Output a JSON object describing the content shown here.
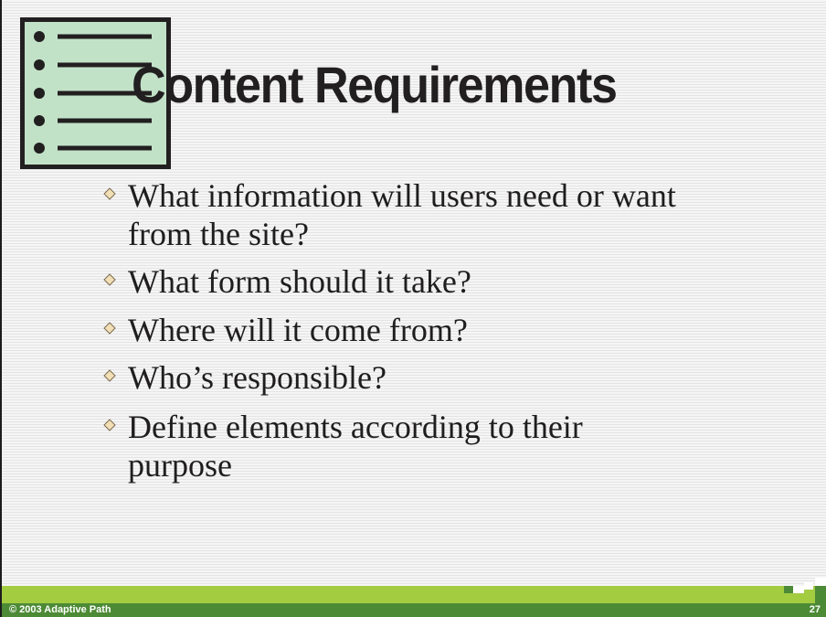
{
  "slide": {
    "title": "Content Requirements",
    "bullets": [
      "What information will users need or want from the site?",
      "What form should it take?",
      "Where will it come from?",
      "Who’s responsible?",
      "Define elements according to their purpose"
    ]
  },
  "footer": {
    "copyright": "© 2003 Adaptive Path",
    "page_number": "27"
  },
  "icons": {
    "title_icon": "bulleted-list-icon",
    "bullet_marker": "diamond-bullet-icon"
  },
  "colors": {
    "footer_light_green": "#a3cc41",
    "footer_dark_green": "#4c8a35",
    "list_icon_fill": "#c2e2c8",
    "text": "#1f1d1e",
    "diamond_fill": "#f3dfb5"
  }
}
